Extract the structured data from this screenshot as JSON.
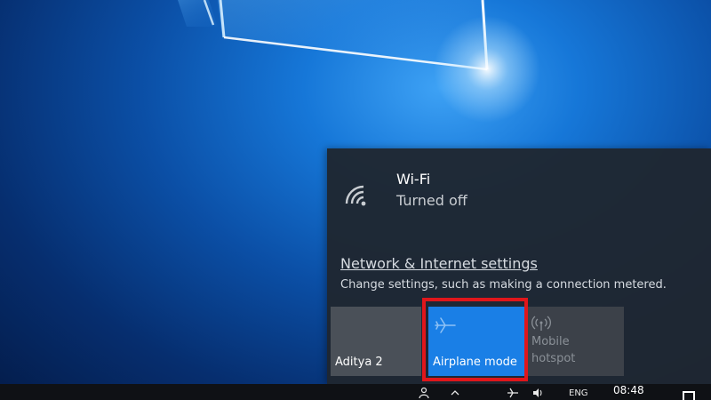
{
  "wifi": {
    "name": "Wi-Fi",
    "status": "Turned off",
    "icon": "wifi-icon"
  },
  "network_settings": {
    "link_label": "Network & Internet settings",
    "description": "Change settings, such as making a connection metered."
  },
  "quick_actions": [
    {
      "label": "Aditya 2",
      "icon": "vpn-icon"
    },
    {
      "label": "Airplane mode",
      "icon": "airplane-icon",
      "active": true
    },
    {
      "label": "Mobile hotspot",
      "icon": "hotspot-icon",
      "active": false
    }
  ],
  "taskbar": {
    "time": "08:48",
    "language": "ENG"
  },
  "colors": {
    "accent": "#1a7fe6",
    "highlight": "#e0161b",
    "flyout_bg": "#1f2630"
  }
}
